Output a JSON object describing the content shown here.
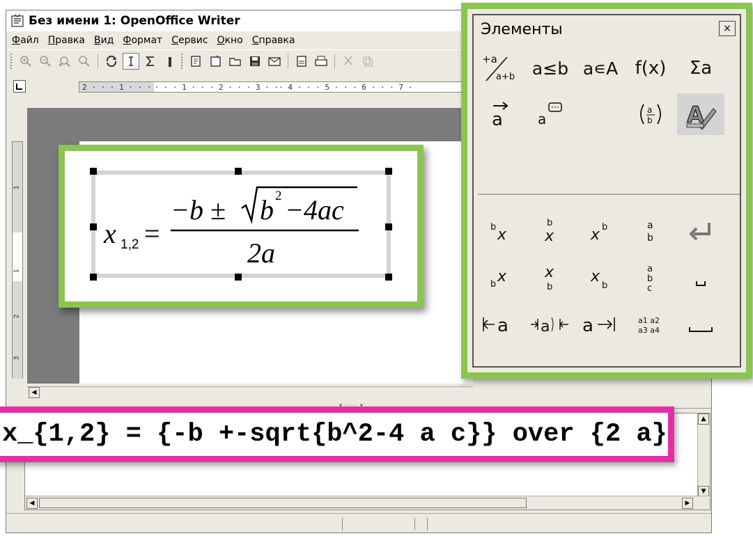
{
  "window": {
    "title": "Без имени 1: OpenOffice Writer"
  },
  "menu": {
    "items": [
      "Файл",
      "Правка",
      "Вид",
      "Формат",
      "Сервис",
      "Окно",
      "Справка"
    ]
  },
  "toolbar": {
    "icons": [
      "zoom-in-icon",
      "zoom-out-icon",
      "zoom-all-icon",
      "zoom-icon",
      "update-icon",
      "formula-cursor-icon",
      "sigma-icon",
      "dropdown-icon",
      "catalog-icon",
      "new-icon",
      "open-icon",
      "save-icon",
      "email-icon",
      "export-pdf-icon",
      "print-icon",
      "cut-icon",
      "copy-icon"
    ]
  },
  "ruler": {
    "text_gray": "2 · · · 1 · · · ",
    "text_main": " · · · 1 · · · 2 · · · 3 · · ",
    "text_right": "· 4 · · · 5 · · · 6 · · · 7 ·",
    "vertical_ticks": [
      "1",
      "1",
      "2",
      "3"
    ]
  },
  "formula": {
    "lhs": "x",
    "subscript": "1,2",
    "equals": "=",
    "numerator_prefix": "−b ±",
    "radicand_b": "b",
    "exponent": "2",
    "radicand_rest": "−4ac",
    "denominator": "2a"
  },
  "elements_panel": {
    "title": "Элементы",
    "close_label": "×",
    "top_row1": [
      "+a/a+b",
      "a≤b",
      "a∊A",
      "f(x)",
      "Σa"
    ],
    "top_row2": [
      "a⃗",
      "a💬",
      "",
      "(a/b)",
      "A✎"
    ],
    "grid_rows": [
      [
        "ᵇx",
        "b over x",
        "xᵇ",
        "a/b stack",
        "↵"
      ],
      [
        "ᵦx",
        "x over b",
        "xᵦ",
        "a b c stack",
        "␣"
      ],
      [
        "⊢a",
        "→|a|←",
        "a→|",
        "a1 a2 a3 a4",
        "⎵"
      ]
    ]
  },
  "command": {
    "text": "x_{1,2} = {-b +-sqrt{b^2-4 a c}} over {2 a}"
  },
  "colors": {
    "green_highlight": "#8bc550",
    "pink_highlight": "#e62ea4",
    "doc_background": "#7b7b7b",
    "window_bg": "#ece9e0"
  }
}
